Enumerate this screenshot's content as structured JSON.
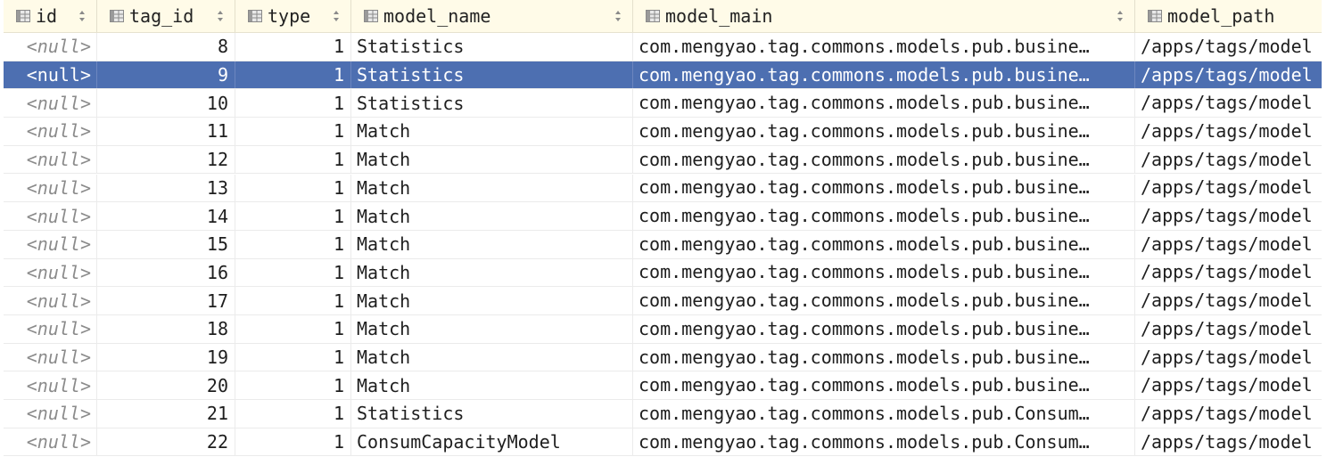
{
  "columns": [
    {
      "name": "id",
      "icon": "column-icon"
    },
    {
      "name": "tag_id",
      "icon": "column-icon"
    },
    {
      "name": "type",
      "icon": "column-icon"
    },
    {
      "name": "model_name",
      "icon": "column-icon"
    },
    {
      "name": "model_main",
      "icon": "column-icon"
    },
    {
      "name": "model_path",
      "icon": "column-icon"
    }
  ],
  "selected_row_index": 1,
  "rows": [
    {
      "id": "<null>",
      "tag_id": "8",
      "type": "1",
      "model_name": "Statistics",
      "model_main": "com.mengyao.tag.commons.models.pub.busine…",
      "model_path": "/apps/tags/model"
    },
    {
      "id": "<null>",
      "tag_id": "9",
      "type": "1",
      "model_name": "Statistics",
      "model_main": "com.mengyao.tag.commons.models.pub.busine…",
      "model_path": "/apps/tags/model"
    },
    {
      "id": "<null>",
      "tag_id": "10",
      "type": "1",
      "model_name": "Statistics",
      "model_main": "com.mengyao.tag.commons.models.pub.busine…",
      "model_path": "/apps/tags/model"
    },
    {
      "id": "<null>",
      "tag_id": "11",
      "type": "1",
      "model_name": "Match",
      "model_main": "com.mengyao.tag.commons.models.pub.busine…",
      "model_path": "/apps/tags/model"
    },
    {
      "id": "<null>",
      "tag_id": "12",
      "type": "1",
      "model_name": "Match",
      "model_main": "com.mengyao.tag.commons.models.pub.busine…",
      "model_path": "/apps/tags/model"
    },
    {
      "id": "<null>",
      "tag_id": "13",
      "type": "1",
      "model_name": "Match",
      "model_main": "com.mengyao.tag.commons.models.pub.busine…",
      "model_path": "/apps/tags/model"
    },
    {
      "id": "<null>",
      "tag_id": "14",
      "type": "1",
      "model_name": "Match",
      "model_main": "com.mengyao.tag.commons.models.pub.busine…",
      "model_path": "/apps/tags/model"
    },
    {
      "id": "<null>",
      "tag_id": "15",
      "type": "1",
      "model_name": "Match",
      "model_main": "com.mengyao.tag.commons.models.pub.busine…",
      "model_path": "/apps/tags/model"
    },
    {
      "id": "<null>",
      "tag_id": "16",
      "type": "1",
      "model_name": "Match",
      "model_main": "com.mengyao.tag.commons.models.pub.busine…",
      "model_path": "/apps/tags/model"
    },
    {
      "id": "<null>",
      "tag_id": "17",
      "type": "1",
      "model_name": "Match",
      "model_main": "com.mengyao.tag.commons.models.pub.busine…",
      "model_path": "/apps/tags/model"
    },
    {
      "id": "<null>",
      "tag_id": "18",
      "type": "1",
      "model_name": "Match",
      "model_main": "com.mengyao.tag.commons.models.pub.busine…",
      "model_path": "/apps/tags/model"
    },
    {
      "id": "<null>",
      "tag_id": "19",
      "type": "1",
      "model_name": "Match",
      "model_main": "com.mengyao.tag.commons.models.pub.busine…",
      "model_path": "/apps/tags/model"
    },
    {
      "id": "<null>",
      "tag_id": "20",
      "type": "1",
      "model_name": "Match",
      "model_main": "com.mengyao.tag.commons.models.pub.busine…",
      "model_path": "/apps/tags/model"
    },
    {
      "id": "<null>",
      "tag_id": "21",
      "type": "1",
      "model_name": "Statistics",
      "model_main": "com.mengyao.tag.commons.models.pub.Consum…",
      "model_path": "/apps/tags/model"
    },
    {
      "id": "<null>",
      "tag_id": "22",
      "type": "1",
      "model_name": "ConsumCapacityModel",
      "model_main": "com.mengyao.tag.commons.models.pub.Consum…",
      "model_path": "/apps/tags/model"
    }
  ],
  "colors": {
    "header_bg": "#fffbe8",
    "selection_bg": "#4d6fb1",
    "null_text": "#8b8b8b"
  }
}
